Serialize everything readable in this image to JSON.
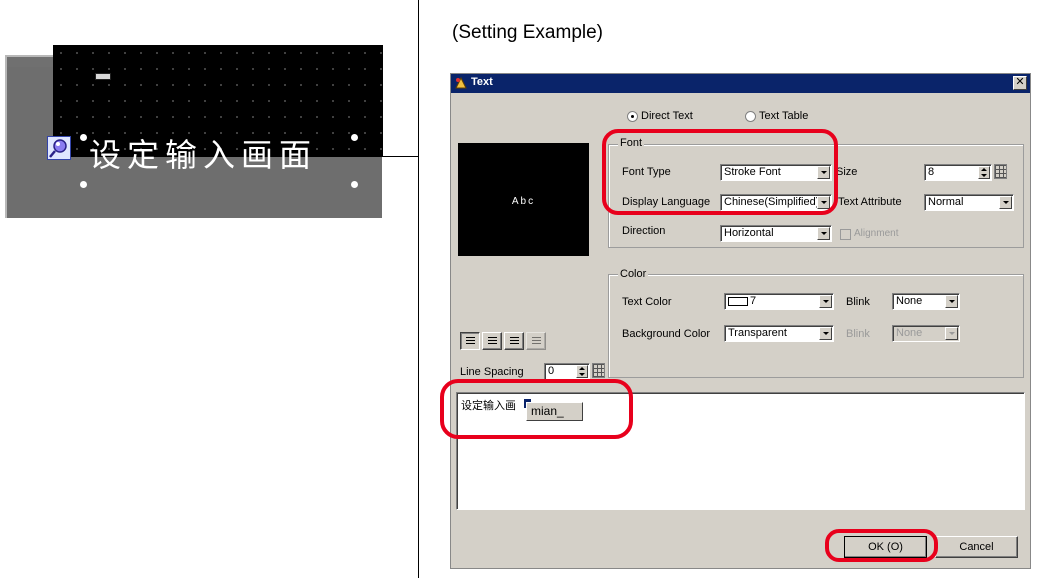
{
  "annotation": {
    "title": "(Setting Example)",
    "editor_text": "设定输入画面"
  },
  "dialog": {
    "title": "Text",
    "close_glyph": "✕",
    "source": {
      "direct_text_label": "Direct Text",
      "text_table_label": "Text Table",
      "selected": "direct_text"
    },
    "preview_text": "Abc",
    "font": {
      "group_label": "Font",
      "font_type_label": "Font Type",
      "font_type_value": "Stroke Font",
      "size_label": "Size",
      "size_value": "8",
      "display_language_label": "Display Language",
      "display_language_value": "Chinese(Simplified)",
      "text_attribute_label": "Text Attribute",
      "text_attribute_value": "Normal",
      "direction_label": "Direction",
      "direction_value": "Horizontal",
      "alignment_label": "Alignment"
    },
    "color": {
      "group_label": "Color",
      "text_color_label": "Text Color",
      "text_color_value": "7",
      "blink_label": "Blink",
      "text_blink_value": "None",
      "background_color_label": "Background Color",
      "background_color_value": "Transparent",
      "background_blink_label": "Blink",
      "background_blink_value": "None"
    },
    "line_spacing_label": "Line Spacing",
    "line_spacing_value": "0",
    "text_input_value": "设定输入画",
    "ime_composition": "mian_",
    "ok_label": "OK (O)",
    "cancel_label": "Cancel"
  },
  "colors": {
    "titlebar": "#0a246a",
    "dialog_face": "#d4d0c8",
    "highlight_oval": "#e8001c"
  },
  "icons": [
    "magnifier-icon",
    "text-tool-icon",
    "close-icon",
    "dropdown-arrow-icon",
    "spin-icon",
    "keypad-icon",
    "align-left-icon",
    "align-center-icon",
    "align-right-icon",
    "align-justify-icon"
  ]
}
